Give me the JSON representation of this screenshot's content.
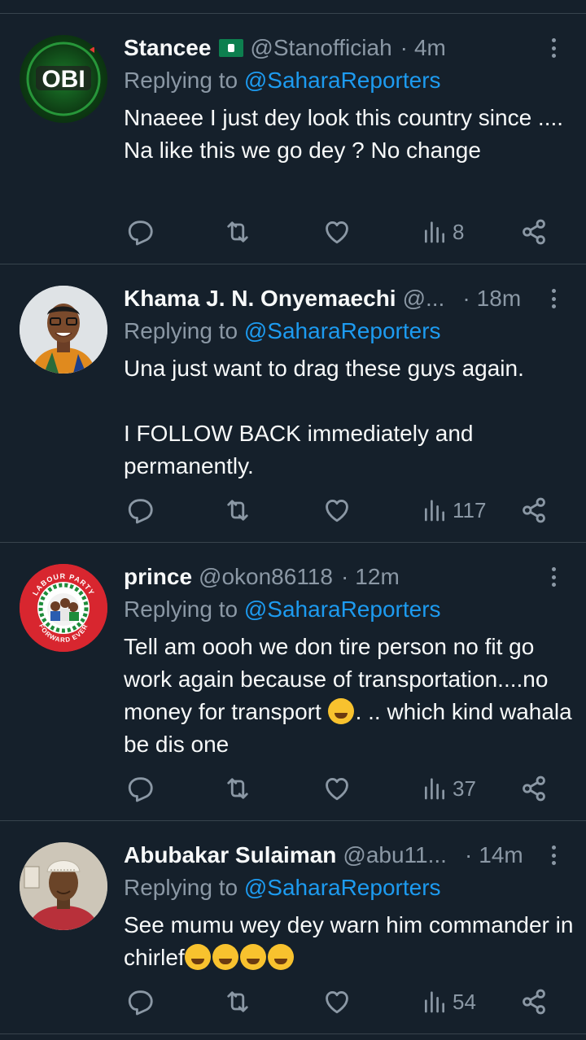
{
  "feed": {
    "tweets": [
      {
        "name": "Stancee",
        "handle": "@Stanofficiah",
        "time": "4m",
        "replying_label": "Replying to",
        "replying_to": "@SaharaReporters",
        "text": "Nnaeee I just dey look this country since .... Na like this we go dey ? No change",
        "views": "8",
        "avatar_text": "OBI"
      },
      {
        "name": "Khama J. N. Onyemaechi",
        "handle": "@...",
        "time": "18m",
        "replying_label": "Replying to",
        "replying_to": "@SaharaReporters",
        "text": "Una just want to drag these guys again.\n\nI FOLLOW BACK immediately and permanently.",
        "views": "117"
      },
      {
        "name": "prince",
        "handle": "@okon86118",
        "time": "12m",
        "replying_label": "Replying to",
        "replying_to": "@SaharaReporters",
        "text_part1": "Tell am oooh we don tire person no fit go work again because of transportation....no money for transport ",
        "text_part2": ".  .. which kind wahala be dis one",
        "views": "37",
        "avatar_text_top": "LABOUR PARTY",
        "avatar_text_bottom": "FORWARD EVER"
      },
      {
        "name": "Abubakar Sulaiman",
        "handle": "@abu11...",
        "time": "14m",
        "replying_label": "Replying to",
        "replying_to": "@SaharaReporters",
        "text": "See mumu wey dey warn him commander in chirlef",
        "views": "54"
      }
    ],
    "separator": "·"
  },
  "colors": {
    "background": "#15202b",
    "text": "#f7f9f9",
    "muted": "#8b98a5",
    "link": "#1d9bf0",
    "divider": "#38444d"
  },
  "icons": [
    "reply-icon",
    "retweet-icon",
    "like-icon",
    "views-icon",
    "share-icon",
    "more-icon",
    "macau-flag-icon"
  ]
}
